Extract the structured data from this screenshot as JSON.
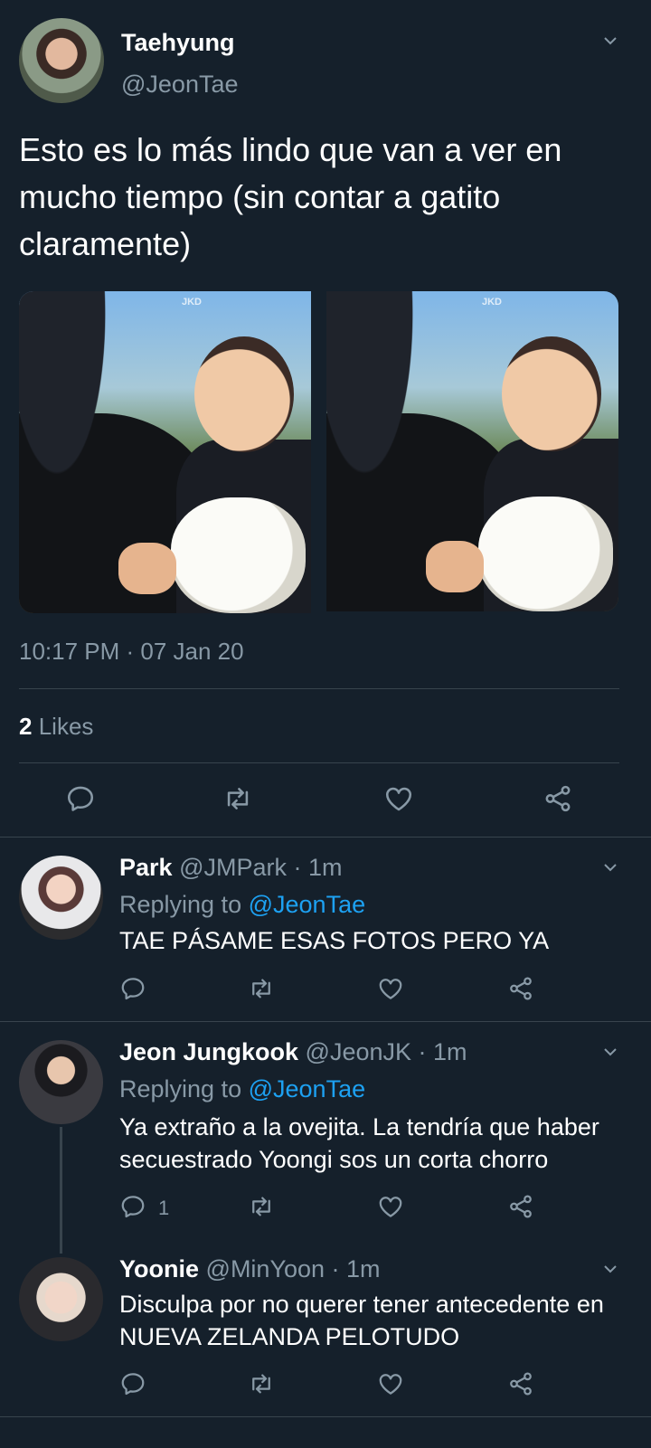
{
  "main_tweet": {
    "display_name": "Taehyung",
    "handle": "@JeonTae",
    "text": "Esto es lo más lindo que van a ver en mucho tiempo (sin contar a gatito claramente)",
    "photo_watermark": "JKD",
    "timestamp": "10:17 PM · 07 Jan 20",
    "likes_count": "2",
    "likes_label": "Likes"
  },
  "replies": [
    {
      "display_name": "Park",
      "handle": "@JMPark",
      "time": "· 1m",
      "replying_prefix": "Replying to",
      "replying_handle": "@JeonTae",
      "text": "TAE PÁSAME ESAS FOTOS PERO YA",
      "reply_count": ""
    },
    {
      "display_name": "Jeon Jungkook",
      "handle": "@JeonJK",
      "time": "· 1m",
      "replying_prefix": "Replying to",
      "replying_handle": "@JeonTae",
      "text": "Ya extraño a la ovejita. La tendría que haber secuestrado Yoongi sos un corta chorro",
      "reply_count": "1"
    },
    {
      "display_name": "Yoonie",
      "handle": "@MinYoon",
      "time": "· 1m",
      "text": "Disculpa por no querer tener antecedente en NUEVA ZELANDA PELOTUDO",
      "reply_count": ""
    }
  ],
  "icons": [
    "chevron-down-icon",
    "reply-icon",
    "retweet-icon",
    "like-icon",
    "share-icon"
  ],
  "colors": {
    "background": "#15202b",
    "muted": "#8899a6",
    "link": "#1da1f2",
    "divider": "#38444d"
  }
}
